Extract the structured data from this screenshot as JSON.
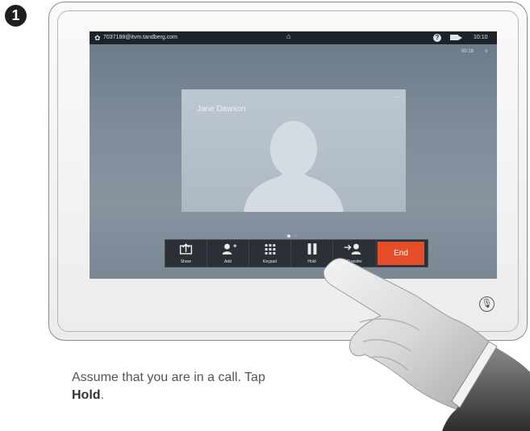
{
  "step": {
    "number": "1"
  },
  "status_bar": {
    "uri": "7037188@itvm.tandberg.com",
    "time": "10:10",
    "help_symbol": "?"
  },
  "call": {
    "timer": "00:16",
    "timer_mark": "≡",
    "participant_name": "Jane Dawson",
    "more_symbol": "…"
  },
  "controls": {
    "share": "Share",
    "add": "Add",
    "keypad": "Keypad",
    "hold": "Hold",
    "transfer": "Transfer",
    "end": "End"
  },
  "caption": {
    "text_1": "Assume that you are in a call. Tap ",
    "text_bold": "Hold",
    "text_2": "."
  },
  "icons": {
    "settings": "gear-icon",
    "home": "home-icon",
    "help": "help-icon",
    "camera": "camera-icon",
    "mute": "microphone-mute-icon"
  },
  "colors": {
    "end_button": "#e64e2a",
    "status_bar": "#1d2329",
    "timer": "#bfe3ff"
  },
  "pager": {
    "total": 2,
    "active": 1
  }
}
